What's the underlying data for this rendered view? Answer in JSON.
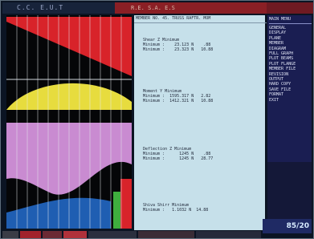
{
  "title_bar": {
    "left_text": "C.C. E.U.T",
    "mid_text": "R.E. S.A. E.S"
  },
  "results_panel": {
    "header": "MEMBER NO. 45. TRUSS RAFTR. MOM",
    "blocks": [
      {
        "title": "Shear Z Minimum",
        "row1": "Minimum :    23.123 N    .88",
        "row2": "Minimum :    23.323 N   10.88"
      },
      {
        "title": "Moment Y Minimum",
        "row1": "Minimum :  1595.317 N   2.82",
        "row2": "Minimum :  1412.321 N   10.88"
      },
      {
        "title": "Deflection Z Minimum",
        "row1": "Minimum :      1245 N    .88",
        "row2": "Minimum :      1245 N   28.77"
      },
      {
        "title": "Shiva Shirr Minimum",
        "row1": "Minimum :   1.1032 N  14.88",
        "row2": ""
      }
    ]
  },
  "menu": {
    "title": "MAIN MENU",
    "items": [
      "GENERAL",
      "DISPLAY",
      "PLANE",
      "MEMBER",
      "DIAGRAM",
      "FULL GRAPH",
      "PLOT BEAMS",
      "PLOT FLANGE",
      "MEMBER FILE",
      "REVISION",
      "OUTPUT",
      "HARD COPY",
      "SAVE FILE",
      "FORMAT",
      "EXIT"
    ]
  },
  "logo_text": "85/20",
  "colors": {
    "red_diagram": "#d8232a",
    "yellow_diagram": "#e7dc3e",
    "pink_diagram": "#c98bd1",
    "blue_diagram": "#1f5eb2",
    "plot_background": "#050608",
    "results_background": "#c6e0ea",
    "menu_background": "#1a1e52"
  }
}
